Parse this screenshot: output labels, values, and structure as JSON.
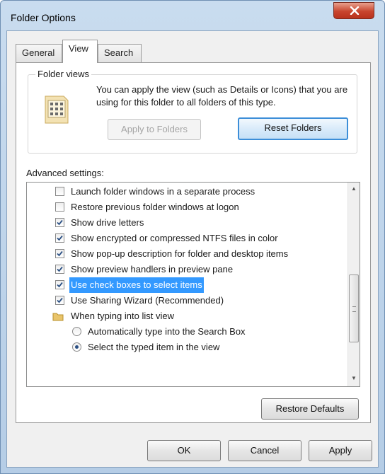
{
  "window": {
    "title": "Folder Options"
  },
  "tabs": [
    {
      "label": "General"
    },
    {
      "label": "View"
    },
    {
      "label": "Search"
    }
  ],
  "folder_views": {
    "label": "Folder views",
    "description": "You can apply the view (such as Details or Icons) that you are using for this folder to all folders of this type.",
    "apply_button": "Apply to Folders",
    "reset_button": "Reset Folders"
  },
  "advanced": {
    "label": "Advanced settings:",
    "items": [
      {
        "type": "checkbox",
        "label": "Launch folder windows in a separate process",
        "checked": false
      },
      {
        "type": "checkbox",
        "label": "Restore previous folder windows at logon",
        "checked": false
      },
      {
        "type": "checkbox",
        "label": "Show drive letters",
        "checked": true
      },
      {
        "type": "checkbox",
        "label": "Show encrypted or compressed NTFS files in color",
        "checked": true
      },
      {
        "type": "checkbox",
        "label": "Show pop-up description for folder and desktop items",
        "checked": true
      },
      {
        "type": "checkbox",
        "label": "Show preview handlers in preview pane",
        "checked": true
      },
      {
        "type": "checkbox",
        "label": "Use check boxes to select items",
        "checked": true,
        "selected": true
      },
      {
        "type": "checkbox",
        "label": "Use Sharing Wizard (Recommended)",
        "checked": true
      },
      {
        "type": "group",
        "label": "When typing into list view"
      },
      {
        "type": "radio",
        "label": "Automatically type into the Search Box",
        "checked": false
      },
      {
        "type": "radio",
        "label": "Select the typed item in the view",
        "checked": true
      }
    ]
  },
  "buttons": {
    "restore_defaults": "Restore Defaults",
    "ok": "OK",
    "cancel": "Cancel",
    "apply": "Apply"
  },
  "colors": {
    "selection": "#3399ff",
    "focus_border": "#3c8ed8",
    "close_button": "#c8452e"
  }
}
